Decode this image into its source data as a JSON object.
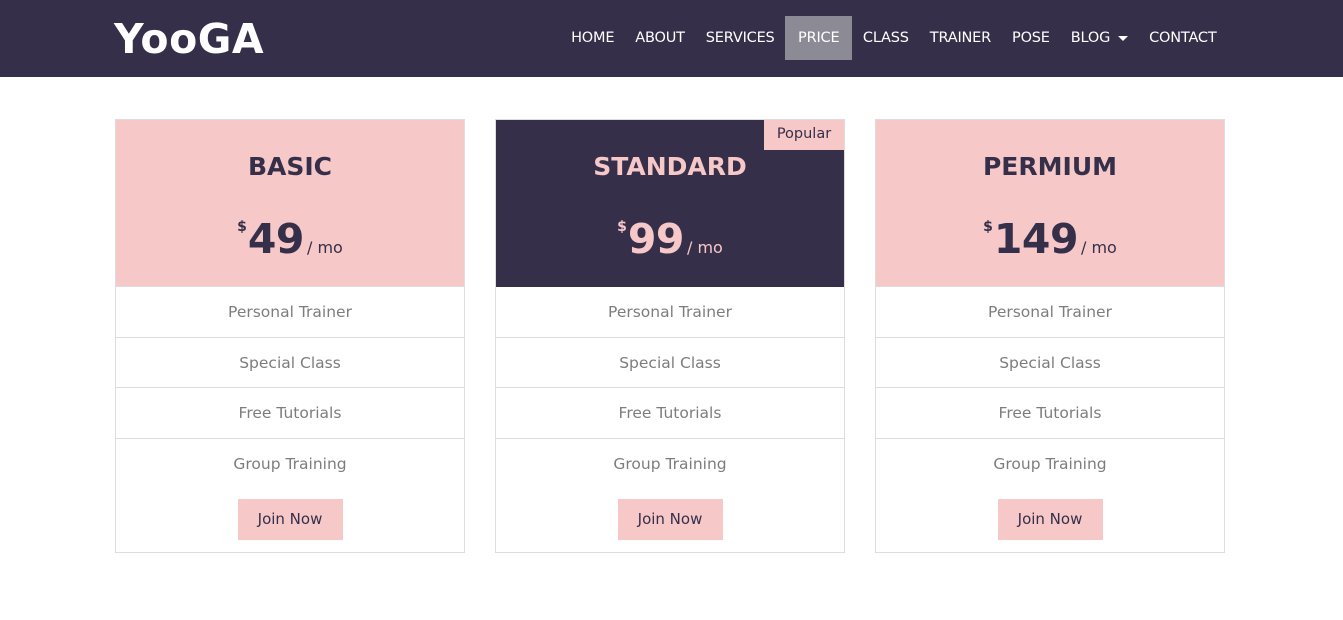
{
  "brand": "YooGA",
  "nav": {
    "items": [
      "HOME",
      "ABOUT",
      "SERVICES",
      "PRICE",
      "CLASS",
      "TRAINER",
      "POSE",
      "BLOG",
      "CONTACT"
    ],
    "active": "PRICE"
  },
  "plans": [
    {
      "name": "BASIC",
      "currency": "$",
      "amount": "49",
      "period": "/ mo",
      "features": [
        "Personal Trainer",
        "Special Class",
        "Free Tutorials",
        "Group Training"
      ],
      "button": "Join Now"
    },
    {
      "name": "STANDARD",
      "badge": "Popular",
      "currency": "$",
      "amount": "99",
      "period": "/ mo",
      "features": [
        "Personal Trainer",
        "Special Class",
        "Free Tutorials",
        "Group Training"
      ],
      "button": "Join Now"
    },
    {
      "name": "PERMIUM",
      "currency": "$",
      "amount": "149",
      "period": "/ mo",
      "features": [
        "Personal Trainer",
        "Special Class",
        "Free Tutorials",
        "Group Training"
      ],
      "button": "Join Now"
    }
  ],
  "colors": {
    "navbar": "#352f4a",
    "accent_pink": "#f6c8c8",
    "active_nav": "#8c8a95",
    "feature_text": "#7d7d7d",
    "border": "#dcdcdc"
  },
  "icons": {
    "dropdown": "caret-down-icon"
  }
}
